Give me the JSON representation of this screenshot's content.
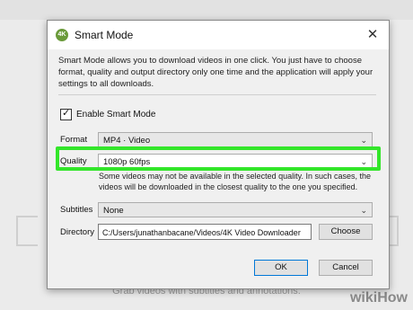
{
  "dialog": {
    "title": "Smart Mode",
    "app_icon_text": "4K",
    "close_glyph": "✕",
    "description": "Smart Mode allows you to download videos in one click. You just have to choose format, quality and output directory only one time and the application will apply your settings to all downloads."
  },
  "enable_smart_mode": {
    "label": "Enable Smart Mode",
    "checked": true,
    "tick": "✓"
  },
  "format": {
    "label": "Format",
    "value": "MP4 · Video"
  },
  "quality": {
    "label": "Quality",
    "value": "1080p 60fps",
    "note": "Some videos may not be available in the selected quality. In such cases, the videos will be downloaded in the closest quality to the one you specified.",
    "highlight_color": "#33e62a"
  },
  "subtitles": {
    "label": "Subtitles",
    "value": "None"
  },
  "directory": {
    "label": "Directory",
    "value": "C:/Users/junathanbacane/Videos/4K Video Downloader",
    "choose_label": "Choose"
  },
  "buttons": {
    "ok": "OK",
    "cancel": "Cancel"
  },
  "background": {
    "caption": "Grab videos with subtitles and annotations."
  },
  "watermark": {
    "wiki": "wiki",
    "how": "How"
  },
  "icons": {
    "chevron": "chevron-down-icon",
    "close": "close-icon",
    "check": "check-icon"
  }
}
